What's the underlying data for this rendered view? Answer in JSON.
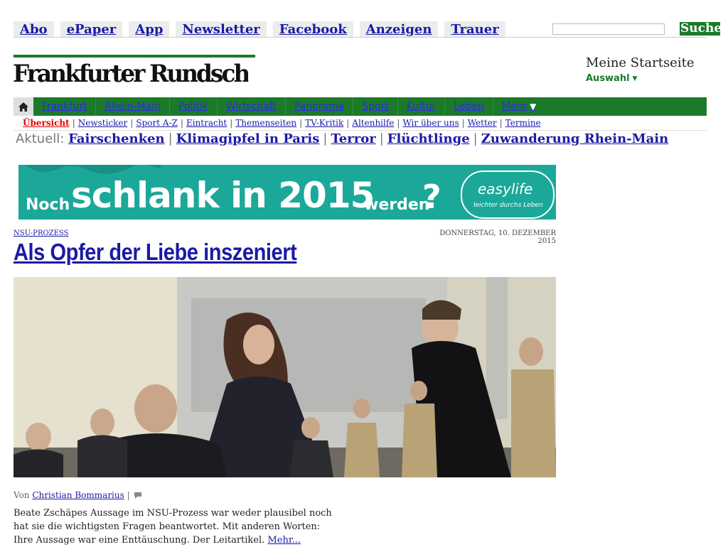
{
  "topbar": {
    "links": [
      "Abo",
      "ePaper",
      "App",
      "Newsletter",
      "Facebook",
      "Anzeigen",
      "Trauer"
    ],
    "search_placeholder": "",
    "search_button": "Suche"
  },
  "logo": {
    "text": "Frankfurter Rundschau"
  },
  "startseite": {
    "title": "Meine Startseite",
    "auswahl": "Auswahl"
  },
  "mainnav": {
    "items": [
      "Frankfurt",
      "Rhein-Main",
      "Politik",
      "Wirtschaft",
      "Panorama",
      "Sport",
      "Kultur",
      "Leben"
    ],
    "more": "Mehr"
  },
  "subnav": {
    "items": [
      "Übersicht",
      "Newsticker",
      "Sport A-Z",
      "Eintracht",
      "Themenseiten",
      "TV-Kritik",
      "Altenhilfe",
      "Wir über uns",
      "Wetter",
      "Termine"
    ]
  },
  "aktuell": {
    "label": "Aktuell:",
    "topics": [
      "Fairschenken",
      "Klimagipfel in Paris",
      "Terror",
      "Flüchtlinge",
      "Zuwanderung Rhein-Main"
    ]
  },
  "banner": {
    "noch": "Noch",
    "big": "schlank in 2015",
    "werden": "werden",
    "question": "?",
    "brand": "easylife",
    "tagline": "leichter durchs Leben"
  },
  "article": {
    "kicker": "NSU-PROZESS",
    "date": "DONNERSTAG, 10. DEZEMBER 2015",
    "headline": "Als Opfer der Liebe inszeniert",
    "byline_prefix": "Von",
    "author": "Christian Bommarius",
    "byline_sep": "|",
    "teaser": "Beate Zschäpes Aussage im NSU-Prozess war weder plausibel noch hat sie die wichtigsten Fragen beantwortet. Mit anderen Worten: Ihre Aussage war eine Enttäuschung. Der Leitartikel.",
    "more": "Mehr..."
  },
  "colors": {
    "brand_green": "#1b7a2a",
    "link_blue": "#1a1aa6",
    "banner_teal": "#1ba899",
    "active_red": "#e10000"
  }
}
